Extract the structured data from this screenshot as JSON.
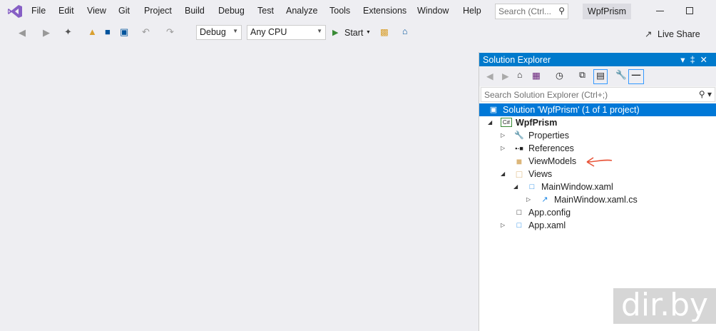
{
  "menu": [
    "File",
    "Edit",
    "View",
    "Git",
    "Project",
    "Build",
    "Debug",
    "Test",
    "Analyze",
    "Tools",
    "Extensions",
    "Window",
    "Help"
  ],
  "search_placeholder": "Search (Ctrl...",
  "window_title": "WpfPrism",
  "toolbar": {
    "config": "Debug",
    "platform": "Any CPU",
    "start": "Start",
    "live_share": "Live Share"
  },
  "solution_explorer": {
    "title": "Solution Explorer",
    "search_placeholder": "Search Solution Explorer (Ctrl+;)",
    "items": [
      {
        "label": "Solution 'WpfPrism' (1 of 1 project)"
      },
      {
        "label": "WpfPrism",
        "icon_text": "C#"
      },
      {
        "label": "Properties"
      },
      {
        "label": "References"
      },
      {
        "label": "ViewModels"
      },
      {
        "label": "Views"
      },
      {
        "label": "MainWindow.xaml"
      },
      {
        "label": "MainWindow.xaml.cs"
      },
      {
        "label": "App.config"
      },
      {
        "label": "App.xaml"
      }
    ]
  },
  "watermark": "dir.by",
  "colors": {
    "accent": "#007acc",
    "selection": "#0078d7",
    "vs_purple": "#68217a",
    "annotation": "#e8553a"
  }
}
